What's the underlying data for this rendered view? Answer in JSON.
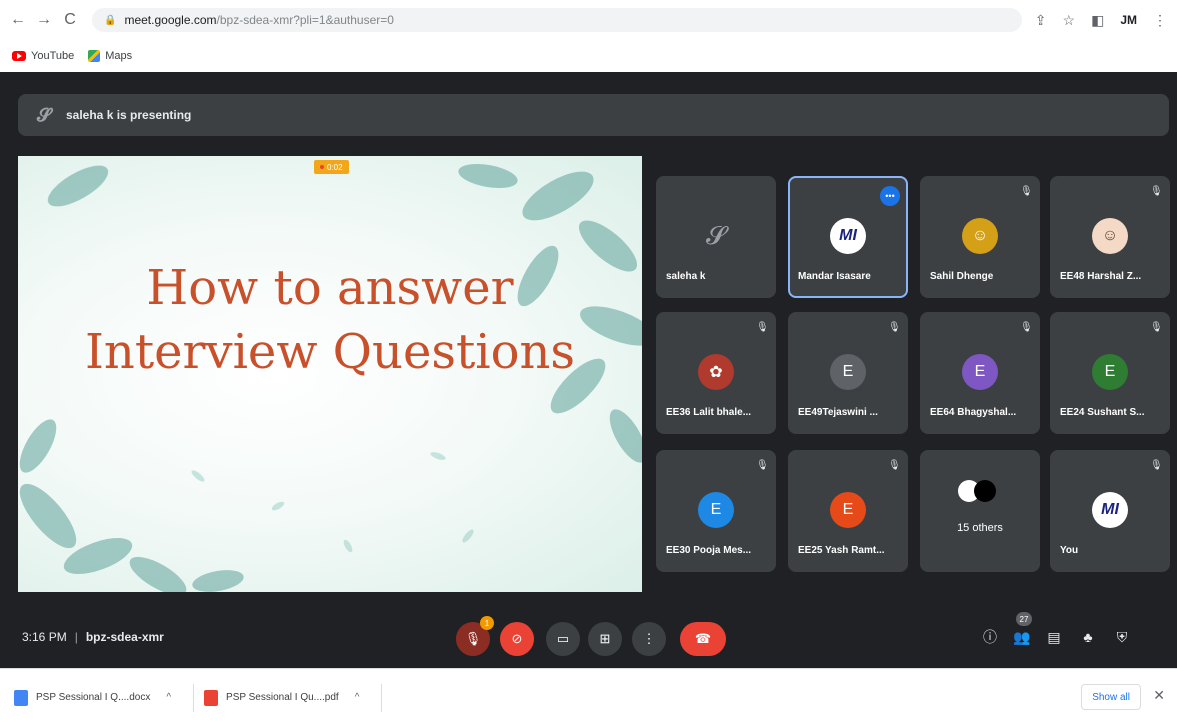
{
  "browser": {
    "url_host": "meet.google.com",
    "url_path": "/bpz-sdea-xmr?pli=1&authuser=0",
    "profile": "JM",
    "bookmarks": [
      {
        "label": "YouTube",
        "icon": "youtube-icon"
      },
      {
        "label": "Maps",
        "icon": "maps-icon"
      }
    ]
  },
  "meet": {
    "presenting_text": "saleha k is presenting",
    "slide": {
      "title_line1": "How to answer",
      "title_line2": "Interview Questions",
      "rec_label": "0:02"
    },
    "tiles": [
      {
        "name": "saleha k",
        "avatar": "S",
        "avatar_color": "#3c4043",
        "muted": false
      },
      {
        "name": "Mandar Isasare",
        "avatar": "MI",
        "avatar_color": "#ffffff",
        "muted": false,
        "active": true
      },
      {
        "name": "Sahil Dhenge",
        "avatar": "",
        "avatar_color": "#d4a017",
        "muted": true
      },
      {
        "name": "EE48 Harshal Z...",
        "avatar": "",
        "avatar_color": "#c0392b",
        "muted": true
      },
      {
        "name": "EE36 Lalit bhale...",
        "avatar": "",
        "avatar_color": "#b03a2e",
        "muted": true
      },
      {
        "name": "EE49Tejaswini ...",
        "avatar": "E",
        "avatar_color": "#5f6368",
        "muted": true
      },
      {
        "name": "EE64 Bhagyshal...",
        "avatar": "E",
        "avatar_color": "#7e57c2",
        "muted": true
      },
      {
        "name": "EE24 Sushant S...",
        "avatar": "E",
        "avatar_color": "#2e7d32",
        "muted": true
      },
      {
        "name": "EE30 Pooja Mes...",
        "avatar": "E",
        "avatar_color": "#1e88e5",
        "muted": true
      },
      {
        "name": "EE25 Yash Ramt...",
        "avatar": "E",
        "avatar_color": "#e64a19",
        "muted": true
      },
      {
        "name": "15 others",
        "avatar": "",
        "muted": false
      },
      {
        "name": "You",
        "avatar": "MI",
        "avatar_color": "#ffffff",
        "muted": true
      }
    ],
    "bottom": {
      "time": "3:16 PM",
      "separator": "|",
      "meeting_code": "bpz-sdea-xmr",
      "raise_hand_badge": "1",
      "participants_count": "27"
    },
    "colors": {
      "background": "#202124",
      "tile": "#3c4043",
      "accent": "#8ab4f8",
      "danger": "#ea4335"
    }
  },
  "downloads": {
    "items": [
      {
        "label": "PSP Sessional I Q....docx",
        "icon": "docx-icon"
      },
      {
        "label": "PSP Sessional I Qu....pdf",
        "icon": "pdf-icon"
      }
    ],
    "show_all": "Show all"
  }
}
